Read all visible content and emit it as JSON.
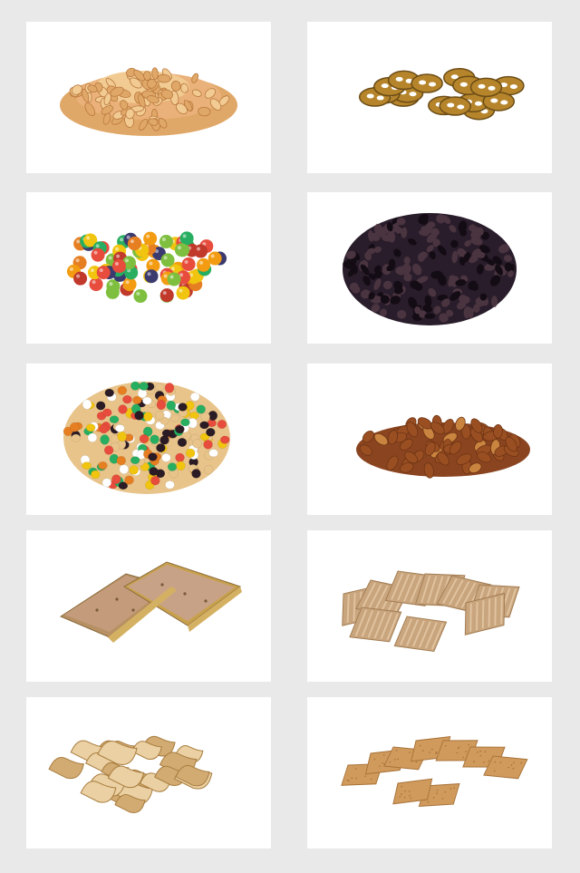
{
  "items": [
    {
      "subject": "peanuts",
      "colors": {
        "base": "#e0a868",
        "light": "#f2cb93",
        "dark": "#b9783d"
      }
    },
    {
      "subject": "pretzel-chips",
      "colors": {
        "base": "#b6852b",
        "light": "#d3a347",
        "dark": "#6b4c16"
      }
    },
    {
      "subject": "candy-coated-chocolates",
      "colors": [
        "#f1c40f",
        "#e74c3c",
        "#27ae60",
        "#e67e22",
        "#3b3a6e",
        "#c0392b",
        "#f39c12",
        "#7fbf3f"
      ]
    },
    {
      "subject": "raisins",
      "colors": {
        "base": "#2a1d2b",
        "light": "#4a3440",
        "dark": "#140c15"
      }
    },
    {
      "subject": "trail-mix",
      "colors": [
        "#e8c48a",
        "#f1c40f",
        "#e74c3c",
        "#27ae60",
        "#e67e22",
        "#2b1b24",
        "#ffffff"
      ]
    },
    {
      "subject": "honey-roasted-peanuts",
      "colors": {
        "base": "#9a4f22",
        "light": "#c9843f",
        "dark": "#6e3414"
      }
    },
    {
      "subject": "toaster-pastries",
      "colors": {
        "base": "#c49c7c",
        "light": "#d8b494",
        "dark": "#9b7450",
        "crust": "#c8a14c"
      }
    },
    {
      "subject": "woven-wheat-crackers",
      "colors": {
        "base": "#c9a57e",
        "light": "#e0c39f",
        "dark": "#a27c52"
      }
    },
    {
      "subject": "pork-rinds",
      "colors": {
        "base": "#d2ab72",
        "light": "#ead0a2",
        "dark": "#a87c3e"
      }
    },
    {
      "subject": "square-wheat-crackers",
      "colors": {
        "base": "#d09a5c",
        "light": "#e6b57a",
        "dark": "#a8733a"
      }
    }
  ]
}
